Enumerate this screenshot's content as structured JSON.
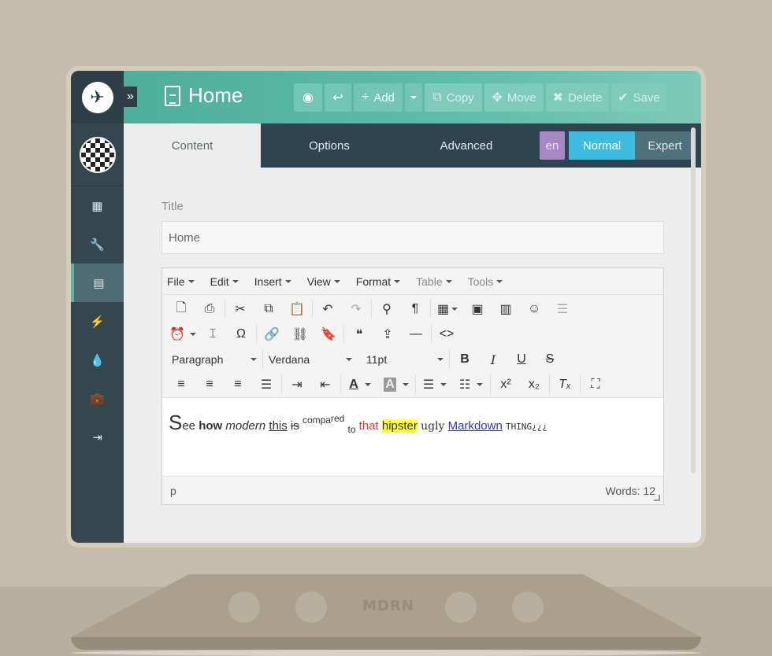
{
  "brand": "MDRN",
  "header": {
    "title": "Home",
    "buttons": [
      {
        "label": ""
      },
      {
        "label": ""
      },
      {
        "label": "Add"
      },
      {
        "label": ""
      },
      {
        "label": "Copy"
      },
      {
        "label": "Move"
      },
      {
        "label": "Delete"
      },
      {
        "label": "Save"
      }
    ]
  },
  "tabs": [
    {
      "label": "Content"
    },
    {
      "label": "Options"
    },
    {
      "label": "Advanced"
    }
  ],
  "lang": "en",
  "modes": {
    "normal": "Normal",
    "expert": "Expert"
  },
  "form": {
    "title_label": "Title",
    "title_value": "Home"
  },
  "editor": {
    "menus": [
      "File",
      "Edit",
      "Insert",
      "View",
      "Format",
      "Table",
      "Tools"
    ],
    "block_format": "Paragraph",
    "font_family": "Verdana",
    "font_size": "11pt",
    "content": {
      "s": "S",
      "ee": "ee",
      "how": "how",
      "modern": "modern",
      "this": "this",
      "is": "is",
      "compa": "compa",
      "red": "red",
      "to": "to",
      "that": "that",
      "hipster": "hipster",
      "ugly": "ugly",
      "markdown": "Markdown",
      "thing": "THING¿¿¿"
    },
    "status_path": "p",
    "word_count": "Words: 12"
  },
  "colors": {
    "accent": "#59b8a0",
    "normal": "#3cbde0",
    "lang": "#a887c4",
    "sidebar": "#34474f"
  }
}
